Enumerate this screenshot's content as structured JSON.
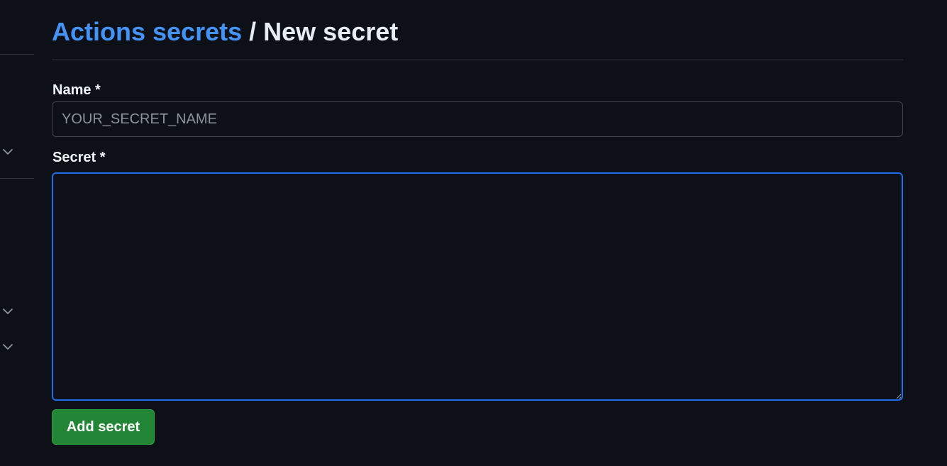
{
  "header": {
    "breadcrumb_link": "Actions secrets",
    "separator": "/",
    "current": "New secret"
  },
  "form": {
    "name_label": "Name *",
    "name_placeholder": "YOUR_SECRET_NAME",
    "name_value": "",
    "secret_label": "Secret *",
    "secret_value": "",
    "submit_label": "Add secret"
  },
  "sidebar": {
    "chevron_icon": "chevron-down-icon"
  },
  "colors": {
    "background": "#0d1117",
    "link": "#4493f8",
    "primary_button": "#238636",
    "focus_border": "#1f6feb",
    "divider": "#30363d"
  }
}
